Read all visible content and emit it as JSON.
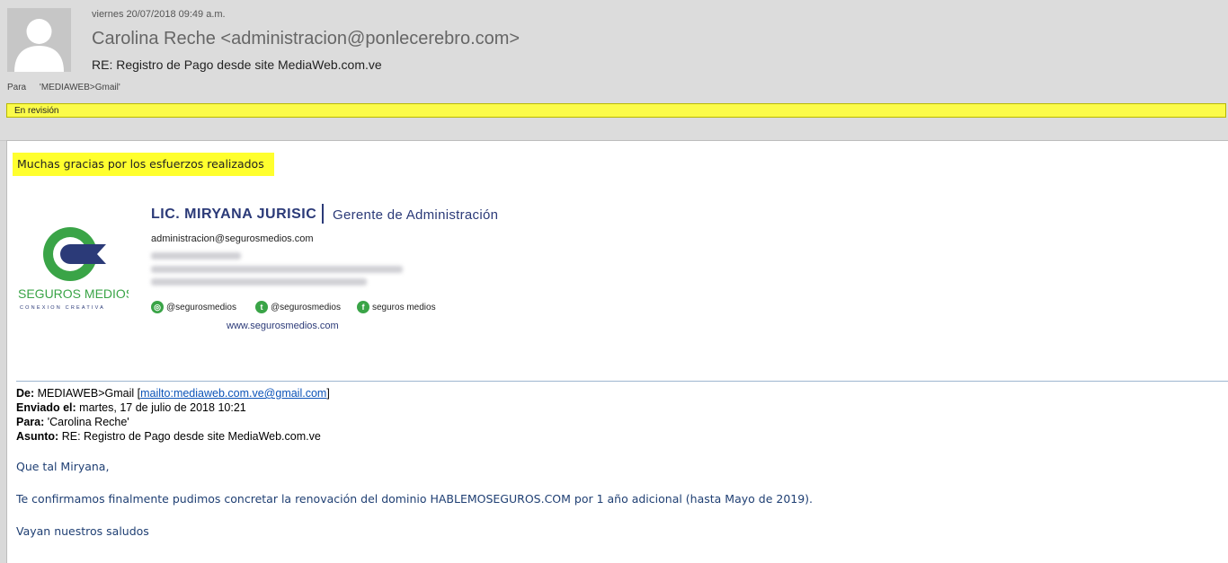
{
  "header": {
    "date": "viernes 20/07/2018 09:49 a.m.",
    "sender": "Carolina Reche <administracion@ponlecerebro.com>",
    "subject": "RE: Registro de Pago desde site MediaWeb.com.ve",
    "to_label": "Para",
    "to_value": "'MEDIAWEB>Gmail'",
    "status": "En revisión"
  },
  "body": {
    "highlight_text": "Muchas gracias por los esfuerzos realizados",
    "signature": {
      "logo_text": "SEGUROS MEDIOS",
      "logo_tagline": "CONEXION CREATIVA",
      "name": "LIC. MIRYANA JURISIC",
      "title": "Gerente de Administración",
      "email": "administracion@segurosmedios.com",
      "instagram": "@segurosmedios",
      "twitter": "@segurosmedios",
      "facebook": "seguros medios",
      "website": "www.segurosmedios.com",
      "brand_colors": {
        "navy": "#2b3a78",
        "green": "#3aa447"
      }
    },
    "quoted": {
      "from_label": "De:",
      "from_value": "MEDIAWEB>Gmail [",
      "from_link": "mailto:mediaweb.com.ve@gmail.com",
      "from_close": "]",
      "sent_label": "Enviado el:",
      "sent_value": "martes, 17 de julio de 2018 10:21",
      "to_label": "Para:",
      "to_value": "'Carolina Reche'",
      "subject_label": "Asunto:",
      "subject_value": "RE: Registro de Pago desde site MediaWeb.com.ve"
    },
    "message": {
      "greeting": "Que tal Miryana,",
      "line1": "Te confirmamos finalmente pudimos concretar la renovación del dominio HABLEMOSEGUROS.COM por 1 año adicional (hasta Mayo de 2019).",
      "closing": "Vayan nuestros saludos"
    }
  },
  "colors": {
    "status_bar": "#fbfb4a",
    "highlight": "#ffff2e",
    "link": "#0b53b8"
  }
}
